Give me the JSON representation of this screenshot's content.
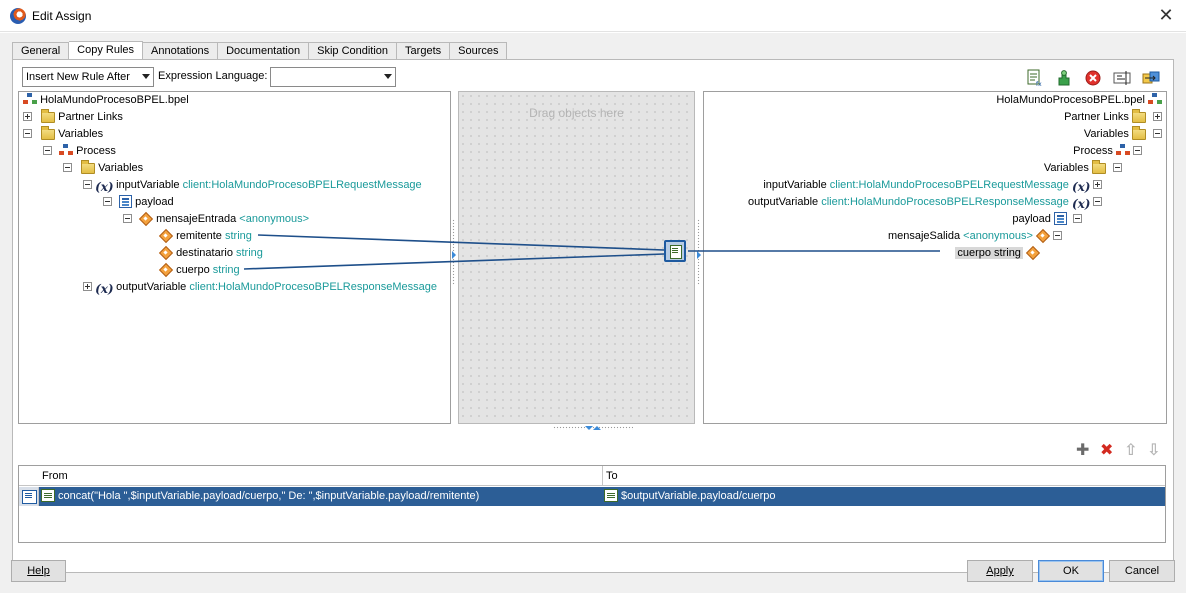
{
  "window": {
    "title": "Edit Assign"
  },
  "tabs": [
    "General",
    "Copy Rules",
    "Annotations",
    "Documentation",
    "Skip Condition",
    "Targets",
    "Sources"
  ],
  "active_tab": "Copy Rules",
  "toolbar": {
    "rule_insert_mode": "Insert New Rule After",
    "expression_language_label": "Expression Language:",
    "expression_language_value": ""
  },
  "source_tree": {
    "root": "HolaMundoProcesoBPEL.bpel",
    "partner_links": "Partner Links",
    "variables": "Variables",
    "process": "Process",
    "process_variables": "Variables",
    "input_variable": {
      "name": "inputVariable",
      "type": "client:HolaMundoProcesoBPELRequestMessage"
    },
    "payload": "payload",
    "mensaje_entrada": {
      "name": "mensajeEntrada",
      "type": "<anonymous>"
    },
    "remitente": {
      "name": "remitente",
      "type": "string"
    },
    "destinatario": {
      "name": "destinatario",
      "type": "string"
    },
    "cuerpo": {
      "name": "cuerpo",
      "type": "string"
    },
    "output_variable": {
      "name": "outputVariable",
      "type": "client:HolaMundoProcesoBPELResponseMessage"
    }
  },
  "drag_area": {
    "hint": "Drag objects here"
  },
  "target_tree": {
    "root": "HolaMundoProcesoBPEL.bpel",
    "partner_links": "Partner Links",
    "variables": "Variables",
    "process": "Process",
    "process_variables": "Variables",
    "input_variable": {
      "name": "inputVariable",
      "type": "client:HolaMundoProcesoBPELRequestMessage"
    },
    "output_variable": {
      "name": "outputVariable",
      "type": "client:HolaMundoProcesoBPELResponseMessage"
    },
    "payload": "payload",
    "mensaje_salida": {
      "name": "mensajeSalida",
      "type": "<anonymous>"
    },
    "cuerpo": {
      "name": "cuerpo",
      "type": "string"
    }
  },
  "rules_table": {
    "columns": {
      "from": "From",
      "to": "To"
    },
    "rows": [
      {
        "from": "concat(\"Hola \",$inputVariable.payload/cuerpo,\" De: \",$inputVariable.payload/remitente)",
        "to": "$outputVariable.payload/cuerpo"
      }
    ]
  },
  "buttons": {
    "help": "Help",
    "apply": "Apply",
    "ok": "OK",
    "cancel": "Cancel"
  },
  "icons": {
    "toolbar": [
      "expression-icon",
      "add-rule-icon",
      "delete-icon",
      "xpath-icon",
      "link-icon"
    ],
    "grid": [
      "add-icon",
      "remove-icon",
      "move-up-icon",
      "move-down-icon"
    ]
  },
  "colors": {
    "type_text": "#1a9a9a",
    "selection": "#2c5e96",
    "connector_line": "#1e4f8a"
  }
}
